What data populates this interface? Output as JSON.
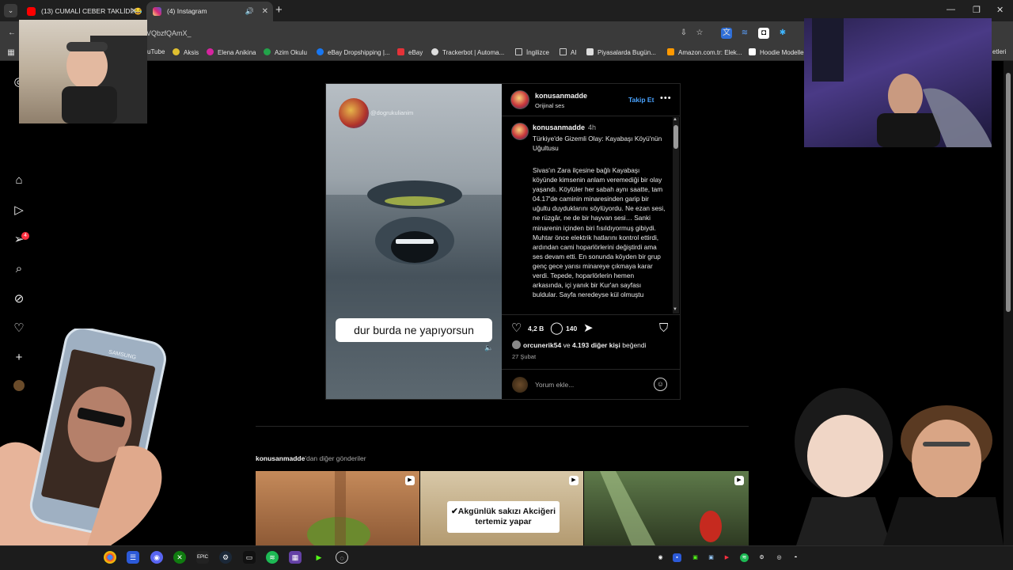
{
  "browser": {
    "tabs": [
      {
        "title": "(13) CUMALİ CEBER TAKLİDİ!😂",
        "active": false,
        "favicon_color": "#ff0000"
      },
      {
        "title": "(4) Instagram",
        "active": true,
        "favicon_color": "#d6249f"
      }
    ],
    "url": "VQbzfQAmX_",
    "bookmarks": [
      {
        "label": "uTube",
        "color": "#ff0000"
      },
      {
        "label": "Aksis",
        "color": "#e0c030"
      },
      {
        "label": "Elena Anikina",
        "color": "#d6249f"
      },
      {
        "label": "Azim Okulu",
        "color": "#22a34a"
      },
      {
        "label": "eBay Dropshipping |...",
        "color": "#1877f2"
      },
      {
        "label": "eBay",
        "color": "#e53238"
      },
      {
        "label": "Trackerbot | Automa...",
        "color": "#dddddd"
      },
      {
        "label": "İngilizce",
        "color": "#888888"
      },
      {
        "label": "AI",
        "color": "#888888"
      },
      {
        "label": "Piyasalarda Bugün...",
        "color": "#dddddd"
      },
      {
        "label": "Amazon.com.tr: Elek...",
        "color": "#ff9900"
      },
      {
        "label": "Hoodie Modelle",
        "color": "#ffffff"
      },
      {
        "label": "etleri",
        "color": "#888888"
      }
    ]
  },
  "nav": {
    "notification_count": "4",
    "items": [
      "instagram-icon",
      "home-icon",
      "reels-icon",
      "messages-icon",
      "search-icon",
      "explore-icon",
      "heart-icon",
      "create-icon",
      "profile-avatar"
    ]
  },
  "post": {
    "media": {
      "watermark": "@dogrukulianim",
      "caption_overlay": "dur burda ne yapıyorsun"
    },
    "header": {
      "username": "konusanmadde",
      "audio": "Orijinal ses",
      "follow_label": "Takip Et"
    },
    "caption": {
      "username": "konusanmadde",
      "time": "4h",
      "title": "Türkiye'de Gizemli Olay: Kayabaşı Köyü'nün Uğultusu",
      "body": "Sivas'ın Zara ilçesine bağlı Kayabaşı köyünde kimsenin anlam veremediği bir olay yaşandı. Köylüler her sabah aynı saatte, tam 04.17'de caminin minaresinden garip bir uğultu duyduklarını söylüyordu. Ne ezan sesi, ne rüzgâr, ne de bir hayvan sesi… Sanki minarenin içinden biri fısıldıyormuş gibiydi. Muhtar önce elektrik hatlarını kontrol ettirdi, ardından cami hoparlörlerini değiştirdi ama ses devam etti. En sonunda köyden bir grup genç gece yarısı minareye çıkmaya karar verdi. Tepede, hoparlörlerin hemen arkasında, içi yanık bir Kur'an sayfası buldular. Sayfa neredeyse kül olmuştu"
    },
    "stats": {
      "likes": "4,2 B",
      "comments": "140"
    },
    "liked_by": {
      "user": "orcunerik54",
      "connector": "ve",
      "others": "4.193 diğer kişi",
      "suffix": "beğendi"
    },
    "date": "27 Şubat",
    "comment_placeholder": "Yorum ekle..."
  },
  "more_posts": {
    "owner": "konusanmadde",
    "suffix": "'dan diğer gönderiler",
    "thumbs": [
      {
        "card_text": ""
      },
      {
        "card_text": "✔Akgünlük sakızı Akciğeri tertemiz yapar"
      },
      {
        "card_text": ""
      }
    ]
  },
  "overlays": {
    "phone_brand": "SAMSUNG"
  },
  "colors": {
    "accent_link": "#4aa3ff",
    "notification_badge": "#ff3040",
    "page_bg": "#000000"
  }
}
